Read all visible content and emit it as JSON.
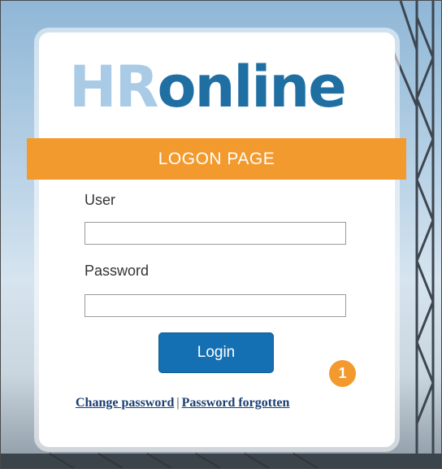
{
  "logo": {
    "hr": "HR",
    "online": "online"
  },
  "banner": {
    "title": "LOGON PAGE"
  },
  "form": {
    "user_label": "User",
    "user_value": "",
    "password_label": "Password",
    "password_value": "",
    "login_label": "Login"
  },
  "badge": {
    "number": "1"
  },
  "links": {
    "change_password": "Change password",
    "separator": "|",
    "password_forgotten": "Password forgotten"
  },
  "colors": {
    "accent_orange": "#f39a2f",
    "brand_blue": "#1570b3",
    "logo_light": "#a9cbe6",
    "logo_dark": "#1f6fa3"
  }
}
